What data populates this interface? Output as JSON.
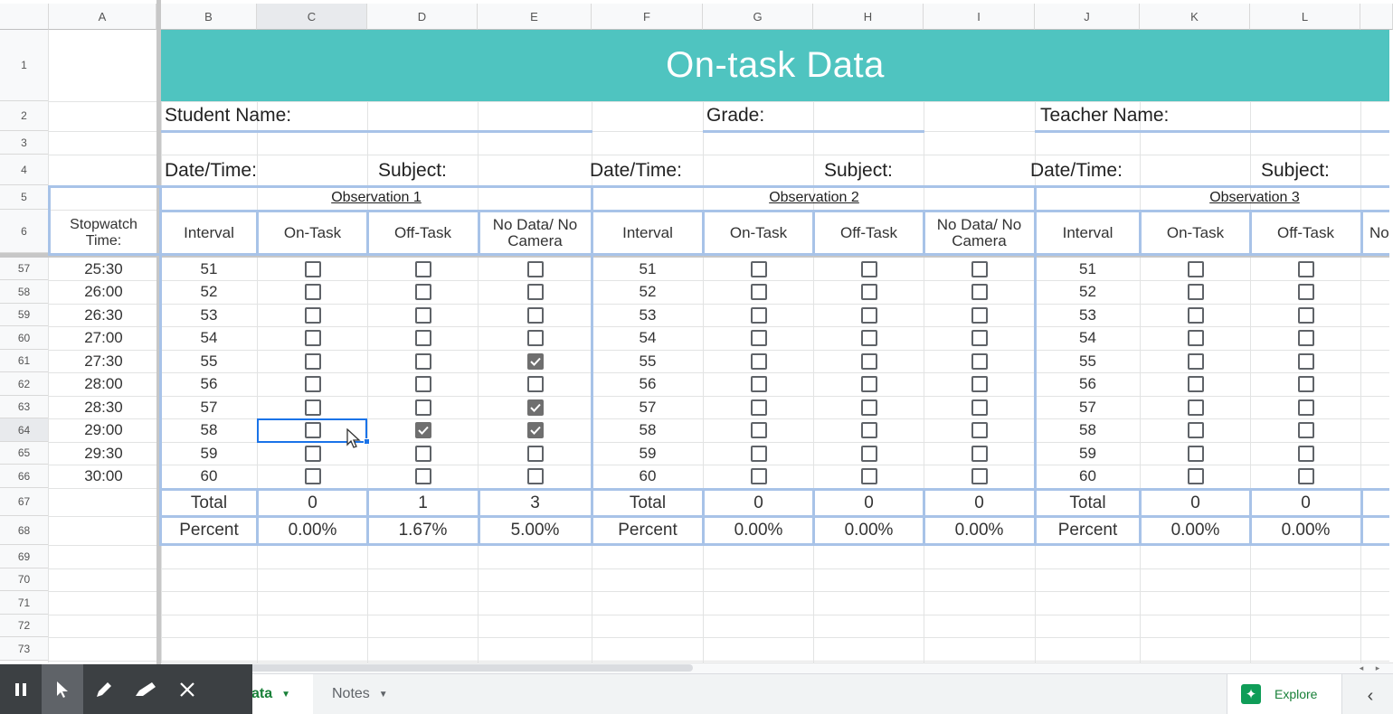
{
  "columns": [
    "A",
    "B",
    "C",
    "D",
    "E",
    "F",
    "G",
    "H",
    "I",
    "J",
    "K",
    "L"
  ],
  "top_rows": [
    "1",
    "2",
    "3",
    "4",
    "5",
    "6"
  ],
  "data_rows": [
    "57",
    "58",
    "59",
    "60",
    "61",
    "62",
    "63",
    "64",
    "65",
    "66",
    "67",
    "68",
    "69",
    "70",
    "71",
    "72",
    "73"
  ],
  "title": "On-task Data",
  "labels": {
    "student_name": "Student Name:",
    "grade": "Grade:",
    "teacher_name": "Teacher Name:",
    "date_time": "Date/Time:",
    "subject": "Subject:"
  },
  "stopwatch_header": "Stopwatch Time:",
  "observations": [
    "Observation 1",
    "Observation 2",
    "Observation 3"
  ],
  "subheaders": [
    "Interval",
    "On-Task",
    "Off-Task",
    "No Data/ No Camera"
  ],
  "times": [
    "25:30",
    "26:00",
    "26:30",
    "27:00",
    "27:30",
    "28:00",
    "28:30",
    "29:00",
    "29:30",
    "30:00"
  ],
  "intervals": [
    "51",
    "52",
    "53",
    "54",
    "55",
    "56",
    "57",
    "58",
    "59",
    "60"
  ],
  "checks_obs1": {
    "on_task": [
      false,
      false,
      false,
      false,
      false,
      false,
      false,
      false,
      false,
      false
    ],
    "off_task": [
      false,
      false,
      false,
      false,
      false,
      false,
      false,
      true,
      false,
      false
    ],
    "no_data": [
      false,
      false,
      false,
      false,
      true,
      false,
      true,
      true,
      false,
      false
    ]
  },
  "total_label": "Total",
  "percent_label": "Percent",
  "totals": {
    "obs1": [
      "0",
      "1",
      "3"
    ],
    "obs2": [
      "0",
      "0",
      "0"
    ],
    "obs3": [
      "0",
      "0"
    ]
  },
  "percents": {
    "obs1": [
      "0.00%",
      "1.67%",
      "5.00%"
    ],
    "obs2": [
      "0.00%",
      "0.00%",
      "0.00%"
    ],
    "obs3": [
      "0.00%",
      "0.00%"
    ]
  },
  "sheet_tabs": [
    {
      "label": "ata",
      "active": true
    },
    {
      "label": "Notes",
      "active": false
    }
  ],
  "explore_label": "Explore",
  "colors": {
    "banner": "#4fc4c0",
    "border_accent": "#a8c3e8",
    "selection": "#1a73e8"
  }
}
